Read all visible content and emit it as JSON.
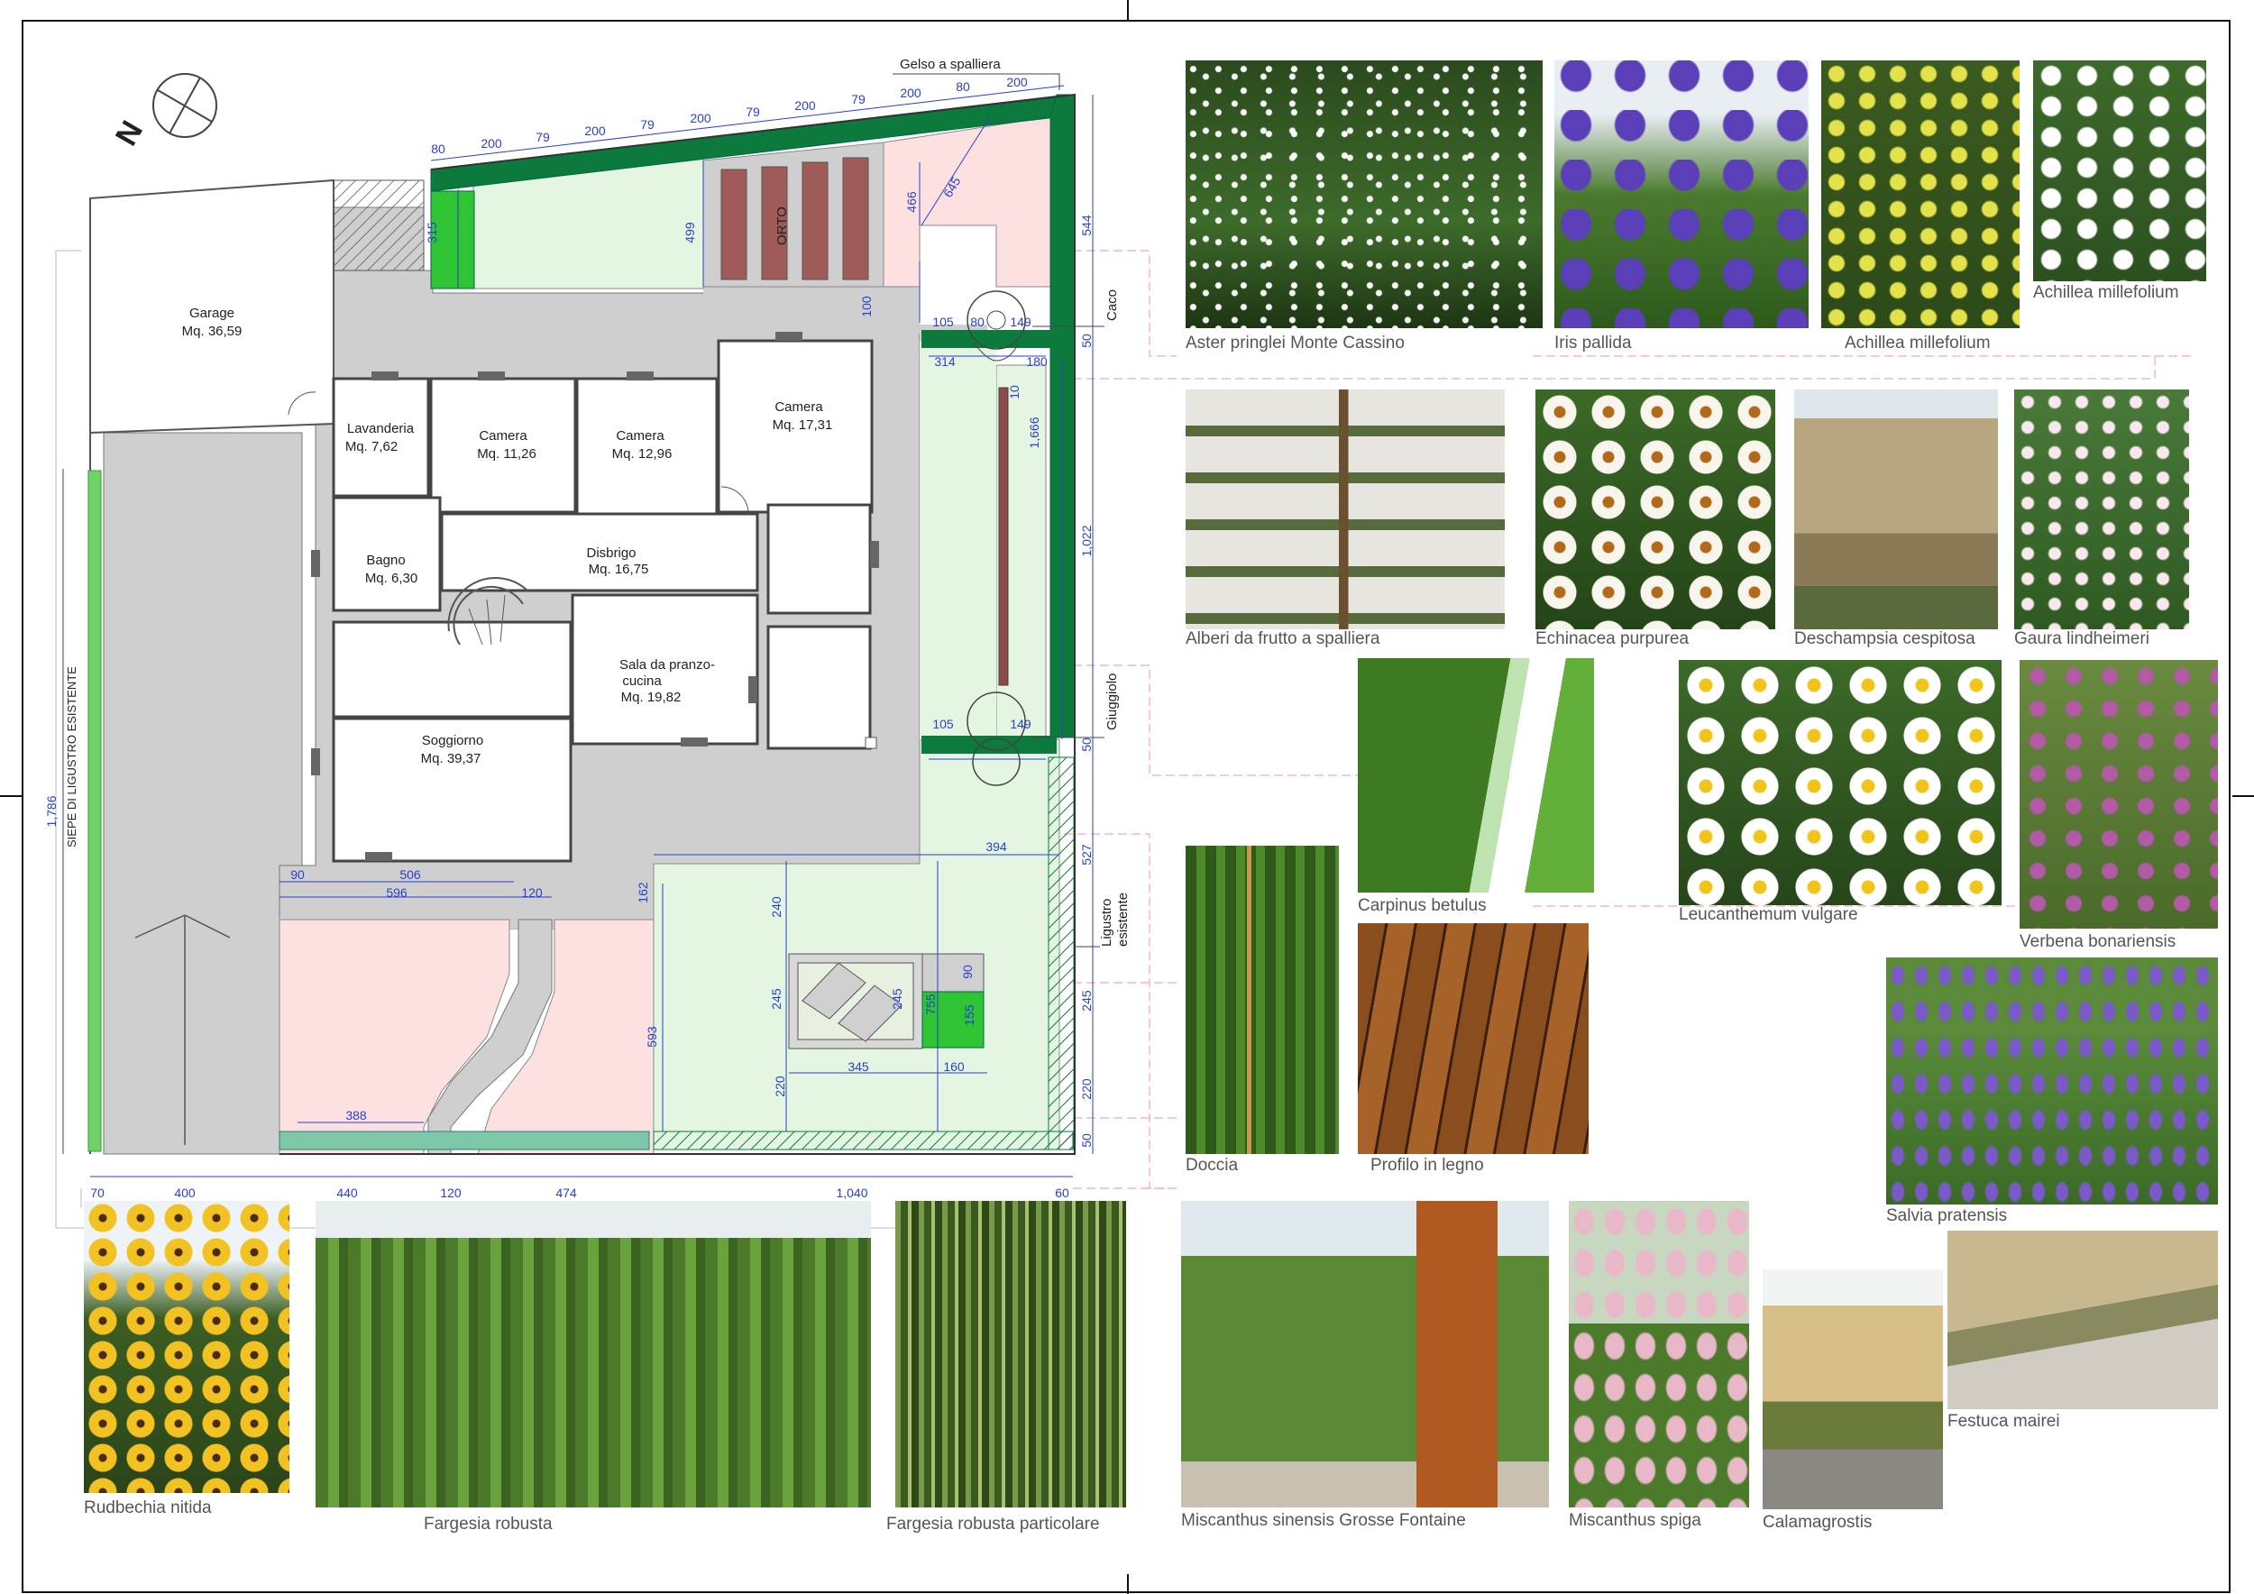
{
  "plan": {
    "rooms": [
      {
        "name": "Garage",
        "area": "Mq. 36,59"
      },
      {
        "name": "Lavanderia",
        "area": "Mq. 7,62"
      },
      {
        "name": "Camera",
        "area": "Mq. 11,26"
      },
      {
        "name": "Camera",
        "area": "Mq. 12,96"
      },
      {
        "name": "Camera",
        "area": "Mq. 17,31"
      },
      {
        "name": "Bagno",
        "area": "Mq. 6,30"
      },
      {
        "name": "Disbrigo",
        "area": "Mq. 16,75"
      },
      {
        "name": "Sala da pranzo-",
        "area": "cucina"
      },
      {
        "name": "Soggiorno",
        "area": "Mq. 39,37"
      }
    ],
    "sala_area": "Mq. 19,82",
    "labels": {
      "north": "N",
      "orto": "ORTO",
      "gelso": "Gelso a spalliera",
      "caco": "Caco",
      "giuggiolo": "Giuggiolo",
      "ligustro_1": "Ligustro",
      "ligustro_2": "esistente",
      "siepe": "SIEPE DI LIGUSTRO ESISTENTE"
    },
    "top_dims": [
      "80",
      "200",
      "79",
      "200",
      "79",
      "200",
      "79",
      "200",
      "79",
      "200",
      "80",
      "200"
    ],
    "bottom_dims": [
      "70",
      "400",
      "440",
      "120",
      "474",
      "1,040",
      "60"
    ],
    "right_dims": [
      "544",
      "50",
      "1,022",
      "50",
      "527",
      "245",
      "220",
      "50"
    ],
    "inner_dims": {
      "d315": "315",
      "d499": "499",
      "d466": "466",
      "d645": "645",
      "d100": "100",
      "d105a": "105",
      "d80": "80",
      "d149a": "149",
      "d314": "314",
      "d180": "180",
      "d10": "10",
      "d1666": "1,666",
      "d105b": "105",
      "d149b": "149",
      "d90": "90",
      "d506": "506",
      "d596": "596",
      "d120": "120",
      "d162": "162",
      "d394": "394",
      "d240": "240",
      "d245a": "245",
      "d245b": "245",
      "d90b": "90",
      "d755": "755",
      "d155": "155",
      "d593": "593",
      "d220": "220",
      "d345": "345",
      "d160": "160",
      "d388": "388",
      "d1786": "1,786"
    }
  },
  "photos": [
    {
      "caption": "Aster pringlei Monte Cassino",
      "icon": "aster-photo"
    },
    {
      "caption": "Iris pallida",
      "icon": "iris-photo"
    },
    {
      "caption": "Achillea millefolium",
      "icon": "yellow-achillea-photo"
    },
    {
      "caption": "Achillea millefolium",
      "icon": "white-achillea-photo"
    },
    {
      "caption": "Alberi da frutto a spalliera",
      "icon": "espalier-tree-photo"
    },
    {
      "caption": "Echinacea purpurea",
      "icon": "echinacea-photo"
    },
    {
      "caption": "Deschampsia cespitosa",
      "icon": "deschampsia-photo"
    },
    {
      "caption": "Gaura lindheimeri",
      "icon": "gaura-photo"
    },
    {
      "caption": "Carpinus betulus",
      "icon": "hedge-photo"
    },
    {
      "caption": "Leucanthemum vulgare",
      "icon": "daisy-photo"
    },
    {
      "caption": "Verbena bonariensis",
      "icon": "verbena-photo"
    },
    {
      "caption": "Doccia",
      "icon": "shower-photo"
    },
    {
      "caption": "Profilo in legno",
      "icon": "wood-photo"
    },
    {
      "caption": "Salvia pratensis",
      "icon": "salvia-photo"
    },
    {
      "caption": "Rudbechia nitida",
      "icon": "rudbeckia-photo"
    },
    {
      "caption": "Fargesia robusta",
      "icon": "bamboo-photo"
    },
    {
      "caption": "Fargesia robusta particolare",
      "icon": "bamboo-detail-photo"
    },
    {
      "caption": "Miscanthus sinensis Grosse Fontaine",
      "icon": "miscanthus-photo"
    },
    {
      "caption": "Miscanthus spiga",
      "icon": "miscanthus-plume-photo"
    },
    {
      "caption": "Calamagrostis",
      "icon": "calamagrostis-photo"
    },
    {
      "caption": "Festuca mairei",
      "icon": "festuca-photo"
    }
  ],
  "colors": {
    "hedge": "#0c7a3c",
    "lawn": "#e4f6e1",
    "paving": "#cfcfcf",
    "pink": "#fde1e1",
    "orto": "#a05a58",
    "dim": "#2a3fd0"
  }
}
